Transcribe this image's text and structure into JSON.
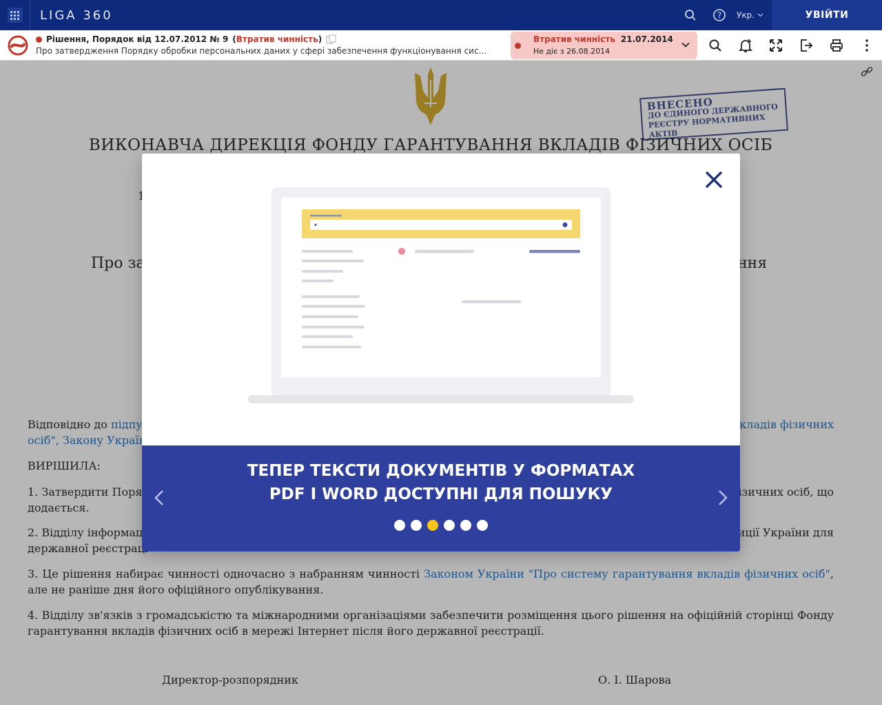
{
  "topbar": {
    "brand": "LIGA 360",
    "lang": "Укр.",
    "login": "УВІЙТИ"
  },
  "doc": {
    "title": "Рішення, Порядок від 12.07.2012 № 9",
    "status": "Втратив чинність",
    "subtitle": "Про затвердження Порядку обробки персональних даних у сфері забезпечення функціонування системи гар...",
    "pill_status": "Втратив чинність",
    "pill_date": "21.07.2014",
    "pill_note": "Не діє з 26.08.2014"
  },
  "page": {
    "stamp_line1": "ВНЕСЕНО",
    "stamp_line2": "ДО ЄДИНОГО ДЕРЖАВНОГО",
    "stamp_line3": "РЕЄСТРУ НОРМАТИВНИХ АКТІВ",
    "org": "ВИКОНАВЧА ДИРЕКЦІЯ ФОНДУ ГАРАНТУВАННЯ ВКЛАДІВ ФІЗИЧНИХ ОСІБ",
    "frag_date": "1",
    "frag_title_left": "Про за",
    "frag_title_right": "ння",
    "p1_a": "Відповідно до ",
    "p1_link1": "підпун",
    "p1_link2": "вкладів фізичних",
    "p1_b_link": "осіб\", Закону Україні",
    "resolved": "ВИРІШИЛА:",
    "p2_a": "1. Затвердити Поряд",
    "p2_b": "ізичних осіб, що",
    "p2_c": "додається.",
    "p3_a": "2. Відділу інформац",
    "p3_b": "иції України для",
    "p3_c": "державної реєстраці",
    "p4_a": "3. Це рішення набирає чинності одночасно з набранням чинності ",
    "p4_link": "Законом України \"Про систему гарантування вкладів фізичних осіб\"",
    "p4_b": ", але не раніше дня його офіційного опублікування.",
    "p5": "4. Відділу зв'язків з громадськістю та міжнародними організаціями забезпечити розміщення цього рішення на офіційній сторінці Фонду гарантування вкладів фізичних осіб в мережі Інтернет після його державної реєстрації.",
    "sign_role": "Директор-розпорядник",
    "sign_name": "О. І. Шарова"
  },
  "modal": {
    "headline_1": "ТЕПЕР ТЕКСТИ ДОКУМЕНТІВ У ФОРМАТАХ",
    "headline_2": "PDF І WORD ДОСТУПНІ ДЛЯ ПОШУКУ",
    "slides_total": 6,
    "active_slide": 3
  },
  "colors": {
    "topbar": "#0d2a7c",
    "modal_footer": "#2e3f9e",
    "accent_yellow": "#f5c518",
    "status_red": "#c0392b",
    "link": "#1a6fc2"
  }
}
